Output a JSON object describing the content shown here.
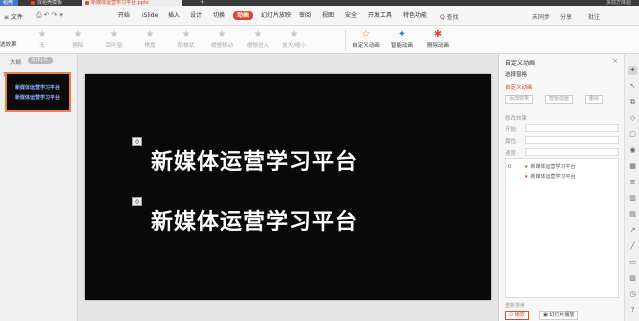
{
  "titlebar": {
    "tabs": [
      "稻壳",
      "找稻壳模板",
      "新媒体运营学习平台.pptx"
    ],
    "add": "+",
    "right": "多前方体验"
  },
  "menubar": {
    "file": "≡ 文件",
    "items": [
      "开始",
      "iSlide",
      "插入",
      "设计",
      "切换",
      "动画",
      "幻灯片放映",
      "审阅",
      "视图",
      "安全",
      "开发工具",
      "特色功能"
    ],
    "active_index": 5,
    "search": "Q 查找",
    "right": [
      "未同步",
      "分享",
      "批注"
    ]
  },
  "ribbon": {
    "first_label": "选效果",
    "items": [
      {
        "label": "无",
        "enabled": false
      },
      {
        "label": "擦除",
        "enabled": false
      },
      {
        "label": "百叶窗",
        "enabled": false
      },
      {
        "label": "棋盘",
        "enabled": false
      },
      {
        "label": "阶梯状",
        "enabled": false
      },
      {
        "label": "缓慢移动",
        "enabled": false
      },
      {
        "label": "缓慢进入",
        "enabled": false
      },
      {
        "label": "放大/缩小",
        "enabled": false
      },
      {
        "label": "自定义动画",
        "enabled": true
      },
      {
        "label": "智能动画",
        "enabled": true
      },
      {
        "label": "删除动画",
        "enabled": true
      }
    ]
  },
  "leftpane": {
    "tabs": [
      "大纲",
      "幻灯片"
    ],
    "slide_number": "1",
    "thumb_lines": [
      "新媒体运营学习平台",
      "新媒体运营学习平台"
    ]
  },
  "slide": {
    "lines": [
      "新媒体运营学习平台",
      "新媒体运营学习平台"
    ],
    "markers": [
      "0",
      "0"
    ]
  },
  "animation_pane": {
    "title": "自定义动画",
    "close": "×",
    "select_pane": "选择窗格",
    "section_custom": "自定义动画",
    "add_effect": "添加效果",
    "smart_animation": "智能动画",
    "delete": "删除",
    "modify_label": "修改效果",
    "fields": [
      "开始:",
      "属性:",
      "速度:"
    ],
    "list": [
      {
        "num": "0",
        "text": "新媒体运营学习平台"
      },
      {
        "num": "",
        "text": "新媒体运营学习平台"
      }
    ],
    "reorder": "重新排序",
    "play": "播放",
    "slideshow": "幻灯片播放"
  },
  "iconstrip": {
    "icons": [
      "pin-icon",
      "select-icon",
      "copy-icon",
      "shape-icon",
      "chat-icon",
      "location-icon",
      "table-icon",
      "bars-icon",
      "chart-icon",
      "grid-icon",
      "share-icon",
      "line-icon",
      "frame-icon",
      "image-icon",
      "clock-icon",
      "help-icon"
    ]
  },
  "colors": {
    "accent": "#d9472b",
    "thumb_border": "#e8834a",
    "slide_bg": "#090909",
    "slide_text": "#ffffff"
  }
}
